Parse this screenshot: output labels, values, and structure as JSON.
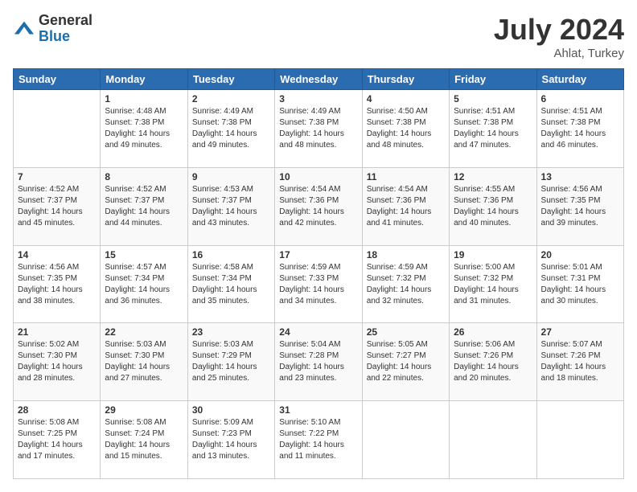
{
  "header": {
    "logo_general": "General",
    "logo_blue": "Blue",
    "title": "July 2024",
    "location": "Ahlat, Turkey"
  },
  "weekdays": [
    "Sunday",
    "Monday",
    "Tuesday",
    "Wednesday",
    "Thursday",
    "Friday",
    "Saturday"
  ],
  "weeks": [
    [
      {
        "day": "",
        "sunrise": "",
        "sunset": "",
        "daylight": ""
      },
      {
        "day": "1",
        "sunrise": "4:48 AM",
        "sunset": "7:38 PM",
        "daylight": "14 hours and 49 minutes."
      },
      {
        "day": "2",
        "sunrise": "4:49 AM",
        "sunset": "7:38 PM",
        "daylight": "14 hours and 49 minutes."
      },
      {
        "day": "3",
        "sunrise": "4:49 AM",
        "sunset": "7:38 PM",
        "daylight": "14 hours and 48 minutes."
      },
      {
        "day": "4",
        "sunrise": "4:50 AM",
        "sunset": "7:38 PM",
        "daylight": "14 hours and 48 minutes."
      },
      {
        "day": "5",
        "sunrise": "4:51 AM",
        "sunset": "7:38 PM",
        "daylight": "14 hours and 47 minutes."
      },
      {
        "day": "6",
        "sunrise": "4:51 AM",
        "sunset": "7:38 PM",
        "daylight": "14 hours and 46 minutes."
      }
    ],
    [
      {
        "day": "7",
        "sunrise": "4:52 AM",
        "sunset": "7:37 PM",
        "daylight": "14 hours and 45 minutes."
      },
      {
        "day": "8",
        "sunrise": "4:52 AM",
        "sunset": "7:37 PM",
        "daylight": "14 hours and 44 minutes."
      },
      {
        "day": "9",
        "sunrise": "4:53 AM",
        "sunset": "7:37 PM",
        "daylight": "14 hours and 43 minutes."
      },
      {
        "day": "10",
        "sunrise": "4:54 AM",
        "sunset": "7:36 PM",
        "daylight": "14 hours and 42 minutes."
      },
      {
        "day": "11",
        "sunrise": "4:54 AM",
        "sunset": "7:36 PM",
        "daylight": "14 hours and 41 minutes."
      },
      {
        "day": "12",
        "sunrise": "4:55 AM",
        "sunset": "7:36 PM",
        "daylight": "14 hours and 40 minutes."
      },
      {
        "day": "13",
        "sunrise": "4:56 AM",
        "sunset": "7:35 PM",
        "daylight": "14 hours and 39 minutes."
      }
    ],
    [
      {
        "day": "14",
        "sunrise": "4:56 AM",
        "sunset": "7:35 PM",
        "daylight": "14 hours and 38 minutes."
      },
      {
        "day": "15",
        "sunrise": "4:57 AM",
        "sunset": "7:34 PM",
        "daylight": "14 hours and 36 minutes."
      },
      {
        "day": "16",
        "sunrise": "4:58 AM",
        "sunset": "7:34 PM",
        "daylight": "14 hours and 35 minutes."
      },
      {
        "day": "17",
        "sunrise": "4:59 AM",
        "sunset": "7:33 PM",
        "daylight": "14 hours and 34 minutes."
      },
      {
        "day": "18",
        "sunrise": "4:59 AM",
        "sunset": "7:32 PM",
        "daylight": "14 hours and 32 minutes."
      },
      {
        "day": "19",
        "sunrise": "5:00 AM",
        "sunset": "7:32 PM",
        "daylight": "14 hours and 31 minutes."
      },
      {
        "day": "20",
        "sunrise": "5:01 AM",
        "sunset": "7:31 PM",
        "daylight": "14 hours and 30 minutes."
      }
    ],
    [
      {
        "day": "21",
        "sunrise": "5:02 AM",
        "sunset": "7:30 PM",
        "daylight": "14 hours and 28 minutes."
      },
      {
        "day": "22",
        "sunrise": "5:03 AM",
        "sunset": "7:30 PM",
        "daylight": "14 hours and 27 minutes."
      },
      {
        "day": "23",
        "sunrise": "5:03 AM",
        "sunset": "7:29 PM",
        "daylight": "14 hours and 25 minutes."
      },
      {
        "day": "24",
        "sunrise": "5:04 AM",
        "sunset": "7:28 PM",
        "daylight": "14 hours and 23 minutes."
      },
      {
        "day": "25",
        "sunrise": "5:05 AM",
        "sunset": "7:27 PM",
        "daylight": "14 hours and 22 minutes."
      },
      {
        "day": "26",
        "sunrise": "5:06 AM",
        "sunset": "7:26 PM",
        "daylight": "14 hours and 20 minutes."
      },
      {
        "day": "27",
        "sunrise": "5:07 AM",
        "sunset": "7:26 PM",
        "daylight": "14 hours and 18 minutes."
      }
    ],
    [
      {
        "day": "28",
        "sunrise": "5:08 AM",
        "sunset": "7:25 PM",
        "daylight": "14 hours and 17 minutes."
      },
      {
        "day": "29",
        "sunrise": "5:08 AM",
        "sunset": "7:24 PM",
        "daylight": "14 hours and 15 minutes."
      },
      {
        "day": "30",
        "sunrise": "5:09 AM",
        "sunset": "7:23 PM",
        "daylight": "14 hours and 13 minutes."
      },
      {
        "day": "31",
        "sunrise": "5:10 AM",
        "sunset": "7:22 PM",
        "daylight": "14 hours and 11 minutes."
      },
      {
        "day": "",
        "sunrise": "",
        "sunset": "",
        "daylight": ""
      },
      {
        "day": "",
        "sunrise": "",
        "sunset": "",
        "daylight": ""
      },
      {
        "day": "",
        "sunrise": "",
        "sunset": "",
        "daylight": ""
      }
    ]
  ]
}
